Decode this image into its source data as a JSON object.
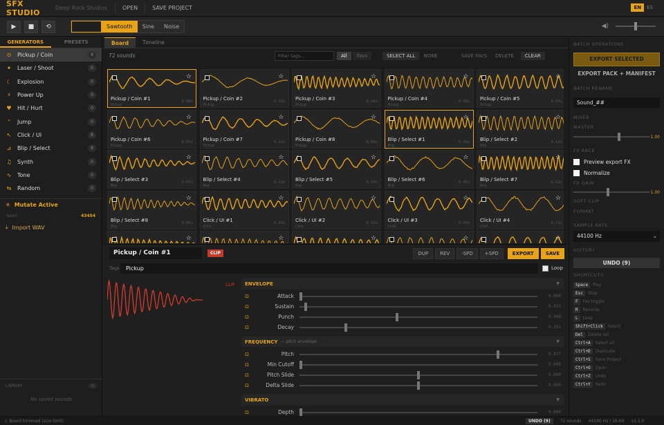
{
  "topbar": {
    "brand": "SFX STUDIO",
    "studio": "Deep Rock Studios",
    "open": "OPEN",
    "save_project": "SAVE PROJECT",
    "lang_en": "EN",
    "lang_es": "ES"
  },
  "transport": {
    "play_icon": "play-icon",
    "stop_icon": "stop-icon",
    "loop_icon": "loop-icon",
    "waves": [
      "Sawtooth",
      "Sine",
      "Noise"
    ],
    "active_wave": "Sawtooth",
    "volume": 0.5
  },
  "left": {
    "tab_generators": "GENERATORS",
    "tab_presets": "PRESETS",
    "generators": [
      {
        "label": "Pickup / Coin",
        "icon": "coin-icon",
        "count": "8"
      },
      {
        "label": "Laser / Shoot",
        "icon": "laser-icon",
        "count": "0"
      },
      {
        "label": "Explosion",
        "icon": "explosion-icon",
        "count": "0"
      },
      {
        "label": "Power Up",
        "icon": "power-up-icon",
        "count": "0"
      },
      {
        "label": "Hit / Hurt",
        "icon": "hit-icon",
        "count": "0"
      },
      {
        "label": "Jump",
        "icon": "jump-icon",
        "count": "0"
      },
      {
        "label": "Click / UI",
        "icon": "click-icon",
        "count": "8"
      },
      {
        "label": "Blip / Select",
        "icon": "blip-icon",
        "count": "8"
      },
      {
        "label": "Synth",
        "icon": "synth-icon",
        "count": "0"
      },
      {
        "label": "Tone",
        "icon": "tone-icon",
        "count": "0"
      },
      {
        "label": "Random",
        "icon": "random-icon",
        "count": "0"
      }
    ],
    "mutate": "Mutate Active",
    "seed_label": "Seed",
    "seed_value": "43454",
    "import": "Import WAV",
    "library_label": "LIBRARY",
    "library_count": "0",
    "library_empty": "No saved sounds"
  },
  "board": {
    "tab_board": "Board",
    "tab_timeline": "Timeline",
    "sound_count": "72 sounds",
    "filter_placeholder": "Filter tags...",
    "filter_all": "All",
    "filter_favs": "Favs",
    "select_all": "SELECT ALL",
    "none": "NONE",
    "save_favs": "SAVE FAVS",
    "delete": "DELETE",
    "clear": "CLEAR",
    "cards": [
      {
        "name": "Pickup / Coin #1",
        "sub": "Pickup",
        "dur": "0.08s"
      },
      {
        "name": "Pickup / Coin #2",
        "sub": "Pickup",
        "dur": "0.10s"
      },
      {
        "name": "Pickup / Coin #3",
        "sub": "Pickup",
        "dur": "0.28s"
      },
      {
        "name": "Pickup / Coin #4",
        "sub": "Pickup",
        "dur": "0.08s"
      },
      {
        "name": "Pickup / Coin #5",
        "sub": "Pickup",
        "dur": "0.03s"
      },
      {
        "name": "Pickup / Coin #6",
        "sub": "Pickup",
        "dur": "0.05s"
      },
      {
        "name": "Pickup / Coin #7",
        "sub": "Pickup",
        "dur": "0.12s"
      },
      {
        "name": "Pickup / Coin #8",
        "sub": "Pickup",
        "dur": "0.09s"
      },
      {
        "name": "Blip / Select #1",
        "sub": "Blip",
        "dur": "0.09s"
      },
      {
        "name": "Blip / Select #2",
        "sub": "Blip",
        "dur": "0.15s"
      },
      {
        "name": "Blip / Select #3",
        "sub": "Blip",
        "dur": "0.06s"
      },
      {
        "name": "Blip / Select #4",
        "sub": "Blip",
        "dur": "0.13s"
      },
      {
        "name": "Blip / Select #5",
        "sub": "Blip",
        "dur": "0.04s"
      },
      {
        "name": "Blip / Select #6",
        "sub": "Blip",
        "dur": "0.06s"
      },
      {
        "name": "Blip / Select #7",
        "sub": "Blip",
        "dur": "0.12s"
      },
      {
        "name": "Blip / Select #8",
        "sub": "Blip",
        "dur": "0.06s"
      },
      {
        "name": "Click / UI #1",
        "sub": "Click",
        "dur": "0.03s"
      },
      {
        "name": "Click / UI #2",
        "sub": "Click",
        "dur": "0.33s"
      },
      {
        "name": "Click / UI #3",
        "sub": "Click",
        "dur": "0.00s"
      },
      {
        "name": "Click / UI #4",
        "sub": "Click",
        "dur": "0.71s"
      },
      {
        "name": "",
        "sub": "",
        "dur": ""
      },
      {
        "name": "",
        "sub": "",
        "dur": ""
      },
      {
        "name": "",
        "sub": "",
        "dur": ""
      },
      {
        "name": "",
        "sub": "",
        "dur": ""
      },
      {
        "name": "",
        "sub": "",
        "dur": ""
      }
    ]
  },
  "editor": {
    "name": "Pickup / Coin #1",
    "clip_badge": "CLIP",
    "dup": "DUP",
    "rev": "REV",
    "minus_spd": "-SPD",
    "plus_spd": "+SPD",
    "export": "EXPORT",
    "save": "SAVE",
    "tags_label": "Tags",
    "tags_value": "Pickup",
    "loop_label": "Loop",
    "clip_label": "CLIP",
    "sections": [
      {
        "title": "ENVELOPE",
        "hint": "",
        "params": [
          {
            "label": "Attack",
            "value": "0.000",
            "level": 0.0
          },
          {
            "label": "Sustain",
            "value": "0.023",
            "level": 0.02
          },
          {
            "label": "Punch",
            "value": "0.408",
            "level": 0.408
          },
          {
            "label": "Decay",
            "value": "0.191",
            "level": 0.191
          }
        ]
      },
      {
        "title": "FREQUENCY",
        "hint": "— pitch envelope",
        "params": [
          {
            "label": "Pitch",
            "value": "0.837",
            "level": 0.837
          },
          {
            "label": "Min Cutoff",
            "value": "0.000",
            "level": 0.0
          },
          {
            "label": "Pitch Slide",
            "value": "0.000",
            "level": 0.5
          },
          {
            "label": "Delta Slide",
            "value": "0.000",
            "level": 0.5
          }
        ]
      },
      {
        "title": "VIBRATO",
        "hint": "",
        "params": [
          {
            "label": "Depth",
            "value": "0.000",
            "level": 0.0
          }
        ]
      }
    ]
  },
  "right": {
    "batch_ops": "BATCH OPERATIONS",
    "export_selected": "EXPORT SELECTED",
    "export_pack": "EXPORT PACK + MANIFEST",
    "batch_rename": "BATCH RENAME",
    "rename_value": "Sound_##",
    "mixer": "MIXER",
    "master_label": "MASTER",
    "master_value": "1.00",
    "master_level": 0.6,
    "fx_rack": "FX RACK",
    "preview_fx": "Preview export FX",
    "normalize": "Normalize",
    "fx_gain": "FX GAIN",
    "fx_gain_value": "1.00",
    "fx_gain_level": 0.45,
    "soft_clip": "SOFT CLIP",
    "format": "FORMAT",
    "sample_rate": "SAMPLE RATE",
    "sample_rate_value": "44100 Hz",
    "history": "HISTORY",
    "undo": "UNDO (9)",
    "shortcuts": "SHORTCUTS",
    "shortcut_list": [
      {
        "key": "Space",
        "desc": "Play"
      },
      {
        "key": "Esc",
        "desc": "Stop"
      },
      {
        "key": "F",
        "desc": "Fav toggle"
      },
      {
        "key": "R",
        "desc": "Reverse"
      },
      {
        "key": "L",
        "desc": "Loop"
      },
      {
        "key": "Shift+Click",
        "desc": "Select"
      },
      {
        "key": "Del",
        "desc": "Delete sel"
      },
      {
        "key": "Ctrl+A",
        "desc": "Select all"
      },
      {
        "key": "Ctrl+D",
        "desc": "Duplicate"
      },
      {
        "key": "Ctrl+S",
        "desc": "Save Project"
      },
      {
        "key": "Ctrl+O",
        "desc": "Open"
      },
      {
        "key": "Ctrl+Z",
        "desc": "Undo"
      },
      {
        "key": "Ctrl+Y",
        "desc": "Redo"
      }
    ]
  },
  "status": {
    "left": "Board trimmed (size limit)",
    "undo": "UNDO (9)",
    "sounds": "72 sounds",
    "format": "44100 Hz / 16-bit",
    "version": "v1.3.0"
  }
}
